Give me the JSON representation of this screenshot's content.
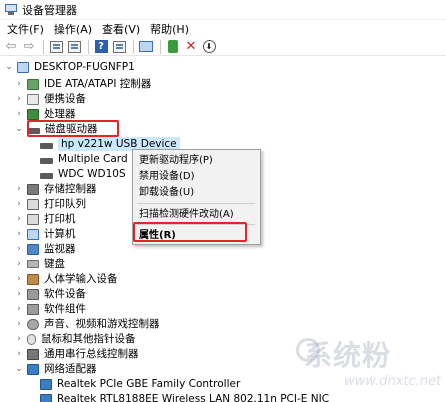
{
  "window": {
    "title": "设备管理器",
    "icon": "device-manager-icon"
  },
  "menubar": {
    "items": [
      "文件(F)",
      "操作(A)",
      "查看(V)",
      "帮助(H)"
    ]
  },
  "toolbar": {
    "buttons": [
      "back-icon",
      "forward-icon",
      "properties-icon",
      "show-hidden-icon",
      "help-icon",
      "monitor-icon",
      "update-driver-icon",
      "uninstall-icon",
      "disable-icon"
    ],
    "help_glyph": "?",
    "back_glyph": "⇦",
    "forward_glyph": "⇨",
    "uninstall_glyph": "✕",
    "disable_glyph": "⬇"
  },
  "tree": {
    "root": "DESKTOP-FUGNFP1",
    "expanded_glyph": "⌄",
    "collapsed_glyph": "›",
    "items": [
      {
        "label": "IDE ATA/ATAPI 控制器"
      },
      {
        "label": "便携设备"
      },
      {
        "label": "处理器"
      },
      {
        "label": "磁盘驱动器",
        "children": [
          "hp v221w USB Device",
          "Multiple Card",
          "WDC WD10S"
        ]
      },
      {
        "label": "存储控制器"
      },
      {
        "label": "打印队列"
      },
      {
        "label": "打印机"
      },
      {
        "label": "计算机"
      },
      {
        "label": "监视器"
      },
      {
        "label": "键盘"
      },
      {
        "label": "人体学输入设备"
      },
      {
        "label": "软件设备"
      },
      {
        "label": "软件组件"
      },
      {
        "label": "声音、视频和游戏控制器"
      },
      {
        "label": "鼠标和其他指针设备"
      },
      {
        "label": "通用串行总线控制器"
      },
      {
        "label": "网络适配器",
        "children": [
          "Realtek PCIe GBE Family Controller",
          "Realtek RTL8188EE Wireless LAN 802.11n PCI-E NIC"
        ]
      }
    ]
  },
  "context_menu": {
    "items": [
      "更新驱动程序(P)",
      "禁用设备(D)",
      "卸载设备(U)",
      "扫描检测硬件改动(A)",
      "属性(R)"
    ]
  },
  "highlight": {
    "color": "#e0262a"
  },
  "colors": {
    "selection": "#cce8ff",
    "accent": "#2b5fb3"
  },
  "watermark": {
    "text": "系统粉",
    "url": "www.dnxtc.net"
  }
}
